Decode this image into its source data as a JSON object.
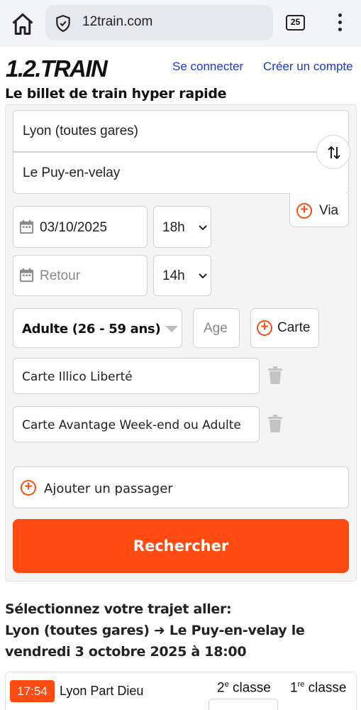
{
  "browser": {
    "url": "12train.com",
    "tab_count": "25"
  },
  "header": {
    "logo": "1.2.TRAIN",
    "login_link": "Se connecter",
    "signup_link": "Créer un compte",
    "tagline": "Le billet de train hyper rapide"
  },
  "form": {
    "from_station": "Lyon (toutes gares)",
    "to_station": "Le Puy-en-velay",
    "via_label": "Via",
    "outbound_date": "03/10/2025",
    "outbound_hour": "18h",
    "return_placeholder": "Retour",
    "return_hour": "14h",
    "passenger_type": "Adulte (26 - 59 ans)",
    "age_placeholder": "Age",
    "card_button": "Carte",
    "cards": [
      "Carte Illico Liberté",
      "Carte Avantage Week-end ou Adulte"
    ],
    "add_passenger": "Ajouter un passager",
    "search_button": "Rechercher"
  },
  "results": {
    "title_line1": "Sélectionnez votre trajet aller:",
    "title_line2": "Lyon (toutes gares) ➜ Le Puy-en-velay le",
    "title_line3": "vendredi 3 octobre 2025 à 18:00",
    "first": {
      "time": "17:54",
      "station": "Lyon Part Dieu",
      "class2_num": "2",
      "class2_sup": "e",
      "class2_word": "classe",
      "class1_num": "1",
      "class1_sup": "re",
      "class1_word": "classe"
    }
  },
  "colors": {
    "accent": "#ff4b12",
    "link": "#1a3ad4"
  }
}
